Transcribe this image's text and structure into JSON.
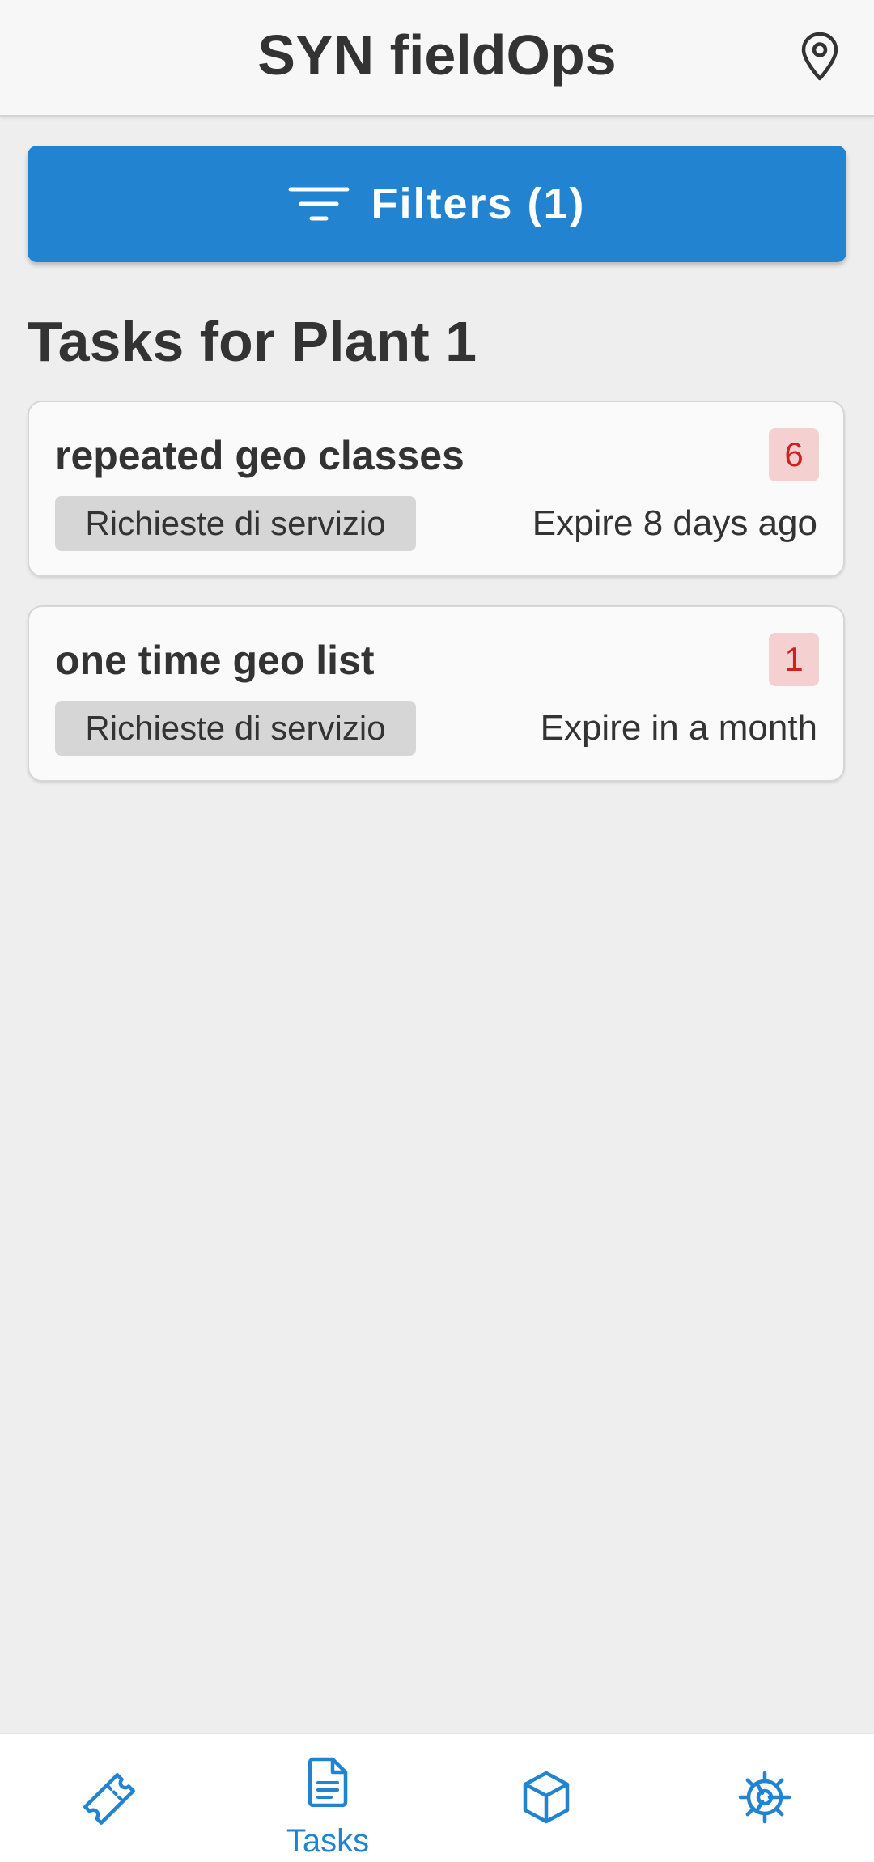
{
  "app": {
    "title": "SYN fieldOps",
    "location_icon": "map-pin-icon"
  },
  "filters": {
    "label": "Filters (1)",
    "icon": "filter-lines-icon"
  },
  "section": {
    "title": "Tasks for Plant 1"
  },
  "tasks": [
    {
      "title": "repeated geo classes",
      "count": "6",
      "category": "Richieste di servizio",
      "expire": "Expire 8 days ago"
    },
    {
      "title": "one time geo list",
      "count": "1",
      "category": "Richieste di servizio",
      "expire": "Expire in a month"
    }
  ],
  "bottom_nav": [
    {
      "icon": "ticket-icon",
      "label": "",
      "active": false
    },
    {
      "icon": "document-icon",
      "label": "Tasks",
      "active": true
    },
    {
      "icon": "cube-icon",
      "label": "",
      "active": false
    },
    {
      "icon": "gear-icon",
      "label": "",
      "active": false
    }
  ],
  "colors": {
    "primary": "#2284d0",
    "badge_bg": "#f5d0d0",
    "badge_text": "#d02020",
    "tag_bg": "#d6d6d6",
    "text": "#333333"
  }
}
